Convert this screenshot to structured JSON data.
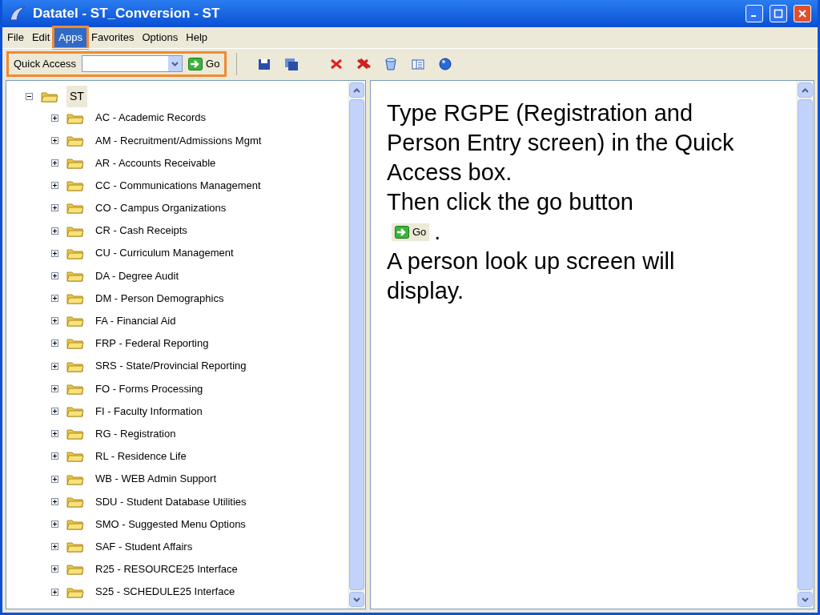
{
  "window": {
    "title": "Datatel - ST_Conversion - ST"
  },
  "menu": [
    {
      "label": "File",
      "selected": false
    },
    {
      "label": "Edit",
      "selected": false
    },
    {
      "label": "Apps",
      "selected": true
    },
    {
      "label": "Favorites",
      "selected": false
    },
    {
      "label": "Options",
      "selected": false
    },
    {
      "label": "Help",
      "selected": false
    }
  ],
  "toolbar": {
    "quick_access": {
      "label": "Quick Access",
      "highlighted": true,
      "go_button": "Go"
    }
  },
  "tree": {
    "label": "ST",
    "expanded": true,
    "selected": true,
    "children": [
      {
        "label": "AC - Academic Records",
        "expanded": false
      },
      {
        "label": "AM - Recruitment/Admissions Mgmt",
        "expanded": false
      },
      {
        "label": "AR - Accounts Receivable",
        "expanded": false
      },
      {
        "label": "CC - Communications Management",
        "expanded": false
      },
      {
        "label": "CO - Campus Organizations",
        "expanded": false
      },
      {
        "label": "CR - Cash Receipts",
        "expanded": false
      },
      {
        "label": "CU - Curriculum Management",
        "expanded": false
      },
      {
        "label": "DA - Degree Audit",
        "expanded": false
      },
      {
        "label": "DM - Person Demographics",
        "expanded": false
      },
      {
        "label": "FA - Financial Aid",
        "expanded": false
      },
      {
        "label": "FRP - Federal Reporting",
        "expanded": false
      },
      {
        "label": "SRS - State/Provincial Reporting",
        "expanded": false
      },
      {
        "label": "FO - Forms Processing",
        "expanded": false
      },
      {
        "label": "FI - Faculty Information",
        "expanded": false
      },
      {
        "label": "RG - Registration",
        "expanded": false
      },
      {
        "label": "RL - Residence Life",
        "expanded": false
      },
      {
        "label": "WB - WEB Admin Support",
        "expanded": false
      },
      {
        "label": "SDU - Student Database Utilities",
        "expanded": false
      },
      {
        "label": "SMO - Suggested Menu Options",
        "expanded": false
      },
      {
        "label": "SAF - Student Affairs",
        "expanded": false
      },
      {
        "label": "R25 - RESOURCE25 Interface",
        "expanded": false
      },
      {
        "label": "S25 - SCHEDULE25 Interface",
        "expanded": false
      }
    ]
  },
  "instructions": {
    "intro": "Type RGPE (Registration and Person Entry screen) in the Quick Access box.",
    "step": "Then click the go button",
    "go_button": "Go",
    "period": ".",
    "result": "A person look up screen will display."
  }
}
